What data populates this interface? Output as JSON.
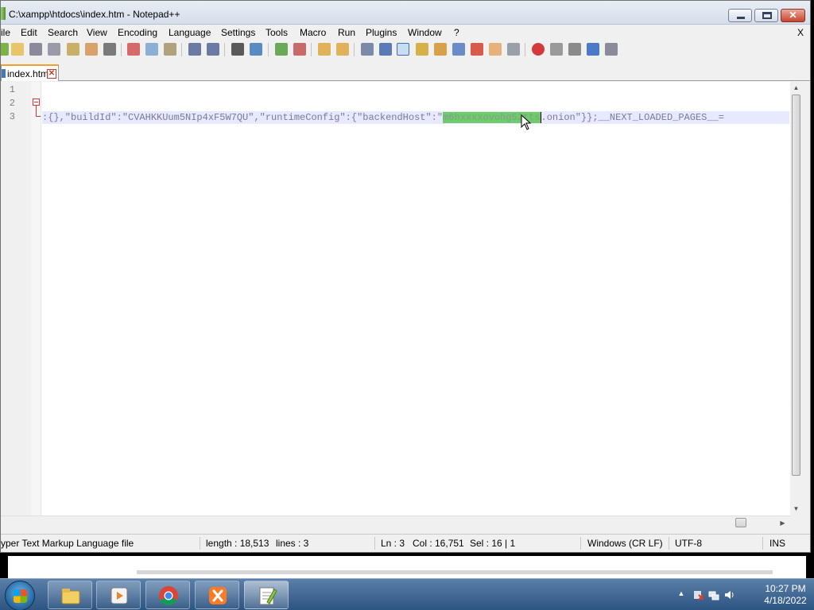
{
  "window": {
    "title": "C:\\xampp\\htdocs\\index.htm - Notepad++",
    "btn_close": "✕"
  },
  "menu": {
    "items": [
      "ile",
      "Edit",
      "Search",
      "View",
      "Encoding",
      "Language",
      "Settings",
      "Tools",
      "Macro",
      "Run",
      "Plugins",
      "Window",
      "?"
    ],
    "close": "X"
  },
  "tab": {
    "label": "index.htm",
    "close": "✕"
  },
  "editor": {
    "line_numbers": [
      "1",
      "2",
      "3"
    ],
    "line3": {
      "before": ":{},\"buildId\":\"CVAHKKUum5NIp4xF5W7QU\",\"runtimeConfig\":{\"backendHost\":\"",
      "selected": "m6hxxxxovohg52tts",
      "after": ".onion\"}};__NEXT_LOADED_PAGES__="
    }
  },
  "status": {
    "file_type": "yper Text Markup Language file",
    "length": "length : 18,513",
    "lines": "lines : 3",
    "ln": "Ln : 3",
    "col": "Col : 16,751",
    "sel": "Sel : 16 | 1",
    "eol": "Windows (CR LF)",
    "encoding": "UTF-8",
    "mode": "INS"
  },
  "taskbar": {
    "time": "10:27 PM",
    "date": "4/18/2022",
    "apps": [
      "explorer-icon",
      "media-player-icon",
      "chrome-icon",
      "xampp-icon",
      "notepadpp-icon"
    ]
  },
  "colors": {
    "selection": "#6fcc6a",
    "active_line": "#e8e8ff",
    "tab_accent": "#f0a12c",
    "taskbar": "#2d5582"
  }
}
